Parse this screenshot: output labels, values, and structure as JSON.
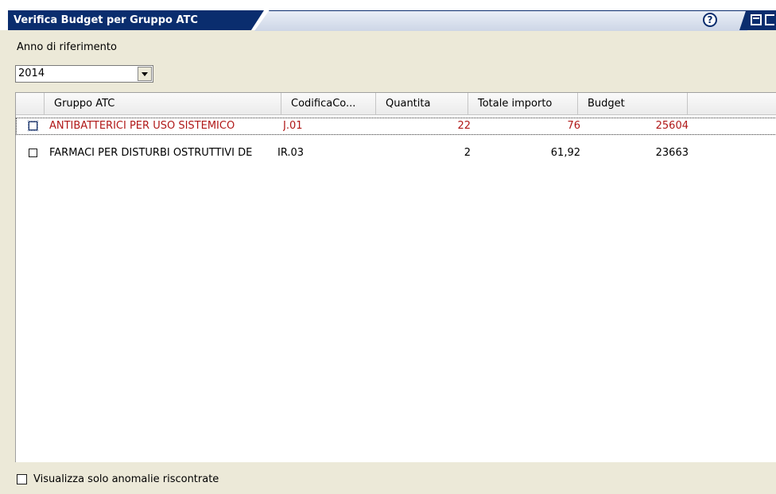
{
  "window": {
    "title": "Verifica Budget per Gruppo ATC",
    "help_glyph": "?"
  },
  "form": {
    "year_label": "Anno di riferimento",
    "year_value": "2014"
  },
  "table": {
    "columns": [
      "Gruppo ATC",
      "CodificaCo...",
      "Quantita",
      "Totale importo",
      "Budget"
    ],
    "rows": [
      {
        "gruppo": "ANTIBATTERICI PER USO SISTEMICO",
        "codifica": "J.01",
        "quantita": "22",
        "totale": "76",
        "budget": "25604",
        "checked": false,
        "selected": true
      },
      {
        "gruppo": "FARMACI PER DISTURBI OSTRUTTIVI DE",
        "codifica": "IR.03",
        "quantita": "2",
        "totale": "61,92",
        "budget": "23663",
        "checked": false,
        "selected": false
      }
    ]
  },
  "filter": {
    "label": "Visualizza solo anomalie riscontrate",
    "checked": false
  },
  "colors": {
    "title_bar": "#0a2d6e",
    "selected_row_text": "#b01818",
    "background": "#ece9d8"
  },
  "icons": [
    "help-icon",
    "restore-icon",
    "close-icon",
    "dropdown-arrow-icon",
    "checkbox-icon"
  ]
}
